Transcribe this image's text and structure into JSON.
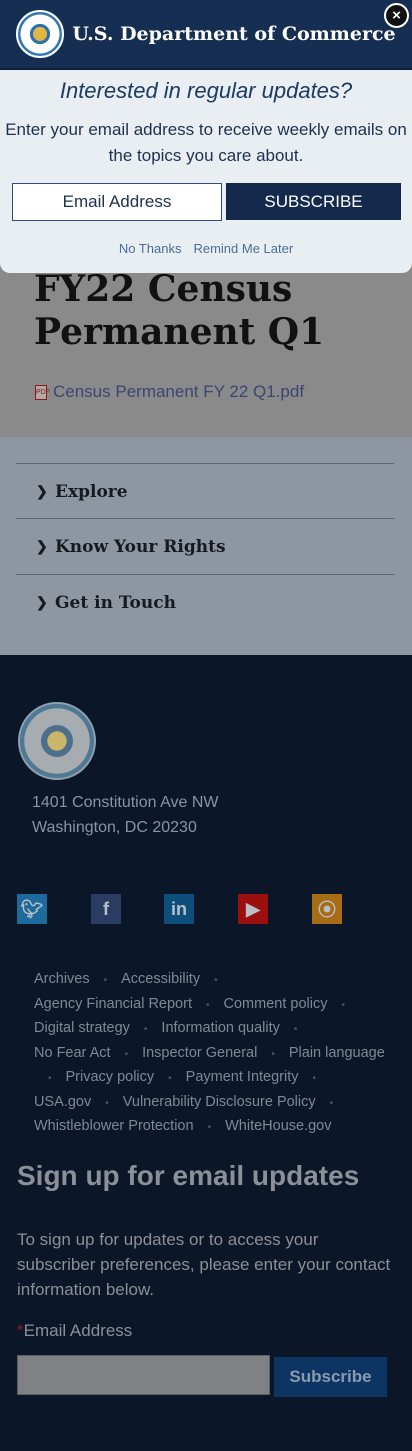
{
  "page": {
    "title": "FY22 Census Permanent Q1",
    "attachment": "Census Permanent FY 22 Q1.pdf"
  },
  "accordion": [
    {
      "label": "Explore"
    },
    {
      "label": "Know Your Rights"
    },
    {
      "label": "Get in Touch"
    }
  ],
  "footer": {
    "address": [
      "1401 Constitution Ave NW",
      "Washington, DC 20230"
    ],
    "social": [
      {
        "icon": "twitter-icon",
        "color": "#1e6a9c"
      },
      {
        "icon": "facebook-icon",
        "color": "#2b3c63"
      },
      {
        "icon": "linkedin-icon",
        "color": "#0d4f7a"
      },
      {
        "icon": "youtube-icon",
        "color": "#9c0f0f"
      },
      {
        "icon": "rss-icon",
        "color": "#a86c14"
      }
    ],
    "links": [
      "Archives",
      "Accessibility",
      "Agency Financial Report",
      "Comment policy",
      "Digital strategy",
      "Information quality",
      "No Fear Act",
      "Inspector General",
      "Plain language",
      "Privacy policy",
      "Payment Integrity",
      "USA.gov",
      "Vulnerability Disclosure Policy",
      "Whistleblower Protection",
      "WhiteHouse.gov"
    ],
    "signup": {
      "heading": "Sign up for email updates",
      "text": "To sign up for updates or to access your subscriber preferences, please enter your contact information below.",
      "required": "*",
      "label": "Email Address",
      "button": "Subscribe"
    }
  },
  "popup": {
    "org": "U.S. Department of Commerce",
    "close": "×",
    "question": "Interested in regular updates?",
    "text": "Enter your email address to receive weekly emails on the topics you care about.",
    "placeholder": "Email Address",
    "subscribe": "SUBSCRIBE",
    "no_thanks": "No Thanks",
    "remind": "Remind Me Later"
  }
}
